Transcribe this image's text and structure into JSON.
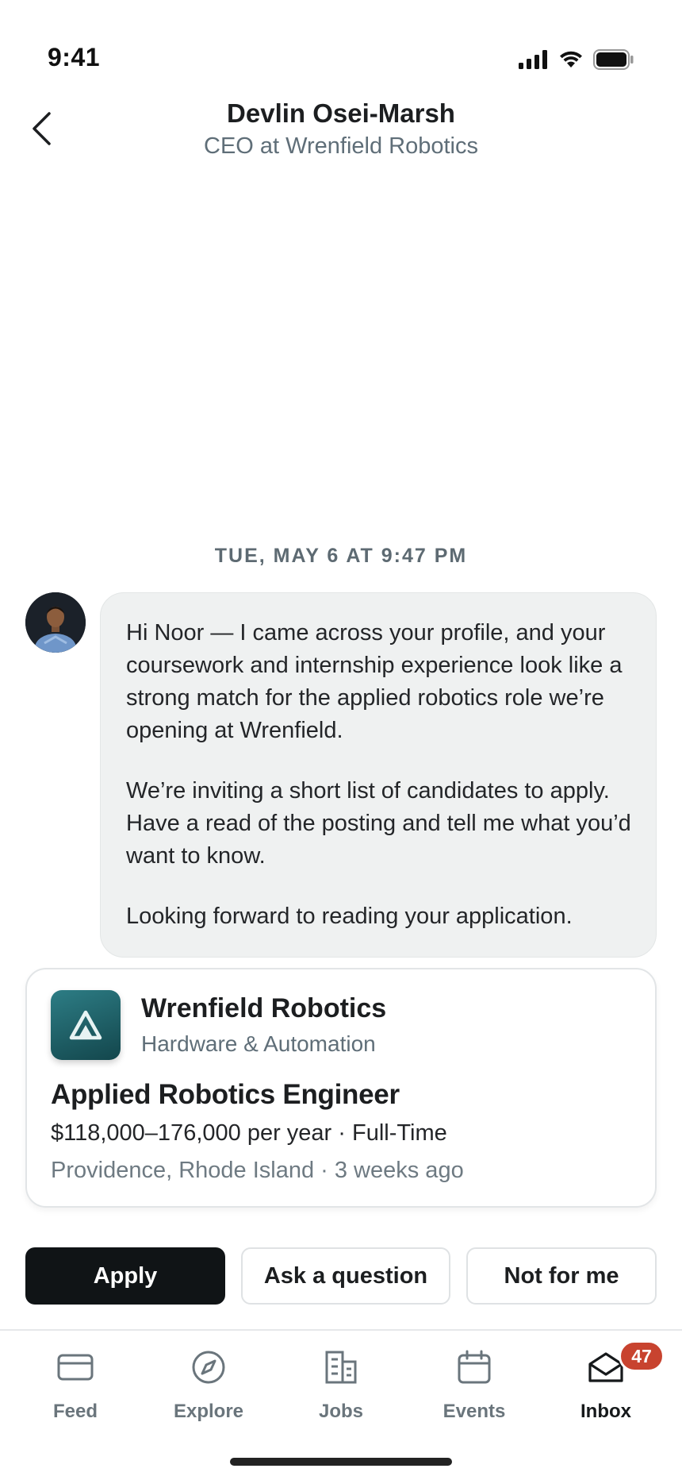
{
  "status_bar": {
    "time": "9:41"
  },
  "header": {
    "name": "Devlin Osei-Marsh",
    "subtitle": "CEO at Wrenfield Robotics"
  },
  "conversation": {
    "date_stamp": "TUE, MAY 6 AT 9:47 PM",
    "message": {
      "paragraphs": [
        "Hi Noor — I came across your profile, and your coursework and internship experience look like a strong match for the applied robotics role we’re opening at Wrenfield.",
        "We’re inviting a short list of candidates to apply. Have a read of the posting and tell me what you’d want to know.",
        "Looking forward to reading your application."
      ]
    }
  },
  "job_card": {
    "company": "Wrenfield Robotics",
    "industry": "Hardware & Automation",
    "title": "Applied Robotics Engineer",
    "salary": "$118,000–176,000 per year · Full-Time",
    "location": "Providence, Rhode Island · 3 weeks ago",
    "logo_color": "#1f5f66"
  },
  "actions": {
    "apply": "Apply",
    "ask": "Ask a question",
    "decline": "Not for me"
  },
  "tabs": [
    {
      "label": "Feed",
      "icon": "card-icon",
      "active": false
    },
    {
      "label": "Explore",
      "icon": "compass-icon",
      "active": false
    },
    {
      "label": "Jobs",
      "icon": "buildings-icon",
      "active": false
    },
    {
      "label": "Events",
      "icon": "calendar-icon",
      "active": false
    },
    {
      "label": "Inbox",
      "icon": "envelope-icon",
      "active": true,
      "badge": "47"
    }
  ],
  "colors": {
    "primary_button": "#101416",
    "badge": "#c8432f",
    "bubble": "#eff1f1"
  }
}
